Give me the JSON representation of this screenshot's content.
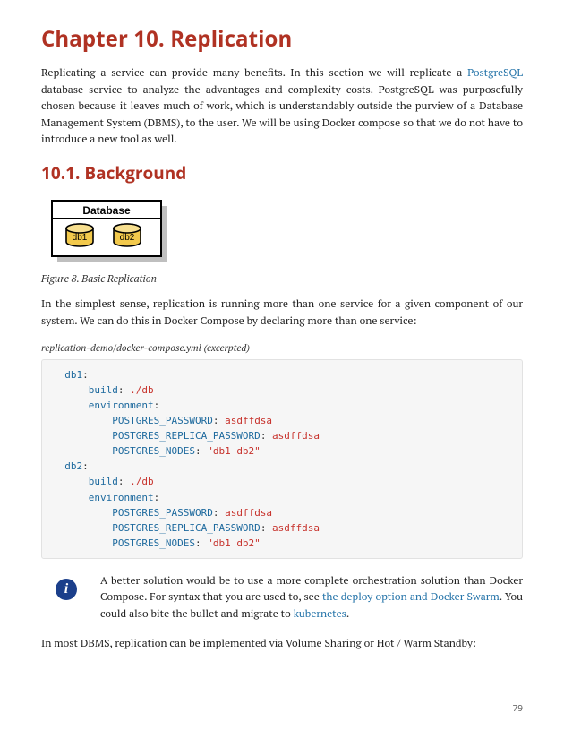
{
  "chapter_title": "Chapter 10. Replication",
  "intro": {
    "pre": "Replicating a service can provide many benefits. In this section we will replicate a ",
    "link1": "PostgreSQL",
    "post": " database service to analyze the advantages and complexity costs. PostgreSQL was purposefully chosen because it leaves much of work, which is understandably outside the purview of a Database Management System (DBMS), to the user. We will be using Docker compose so that we do not have to introduce a new tool as well."
  },
  "section_title": "10.1. Background",
  "figure": {
    "box_label": "Database",
    "db1": "db1",
    "db2": "db2",
    "caption": "Figure 8. Basic Replication"
  },
  "para2": "In the simplest sense, replication is running more than one service for a given component of our system. We can do this in Docker Compose by declaring more than one service:",
  "listing_caption": "replication-demo/docker-compose.yml (excerpted)",
  "code": {
    "l1k": "db1",
    "l1c": ":",
    "l2k": "build",
    "l2c": ":",
    "l2v": " ./db",
    "l3k": "environment",
    "l3c": ":",
    "l4k": "POSTGRES_PASSWORD",
    "l4c": ":",
    "l4v": " asdffdsa",
    "l5k": "POSTGRES_REPLICA_PASSWORD",
    "l5c": ":",
    "l5v": " asdffdsa",
    "l6k": "POSTGRES_NODES",
    "l6c": ":",
    "l6v": " \"db1 db2\"",
    "l7k": "db2",
    "l7c": ":",
    "l8k": "build",
    "l8c": ":",
    "l8v": " ./db",
    "l9k": "environment",
    "l9c": ":",
    "l10k": "POSTGRES_PASSWORD",
    "l10c": ":",
    "l10v": " asdffdsa",
    "l11k": "POSTGRES_REPLICA_PASSWORD",
    "l11c": ":",
    "l11v": " asdffdsa",
    "l12k": "POSTGRES_NODES",
    "l12c": ":",
    "l12v": " \"db1 db2\"",
    "ind1": "  ",
    "ind2": "      ",
    "ind3": "          "
  },
  "admon": {
    "pre": "A better solution would be to use a more complete orchestration solution than Docker Compose. For syntax that you are used to, see ",
    "link1": "the deploy option and Docker Swarm",
    "mid": ". You could also bite the bullet and migrate to ",
    "link2": "kubernetes",
    "post": "."
  },
  "para3": "In most DBMS, replication can be implemented via Volume Sharing or Hot / Warm Standby:",
  "page_number": "79",
  "info_glyph": "i"
}
